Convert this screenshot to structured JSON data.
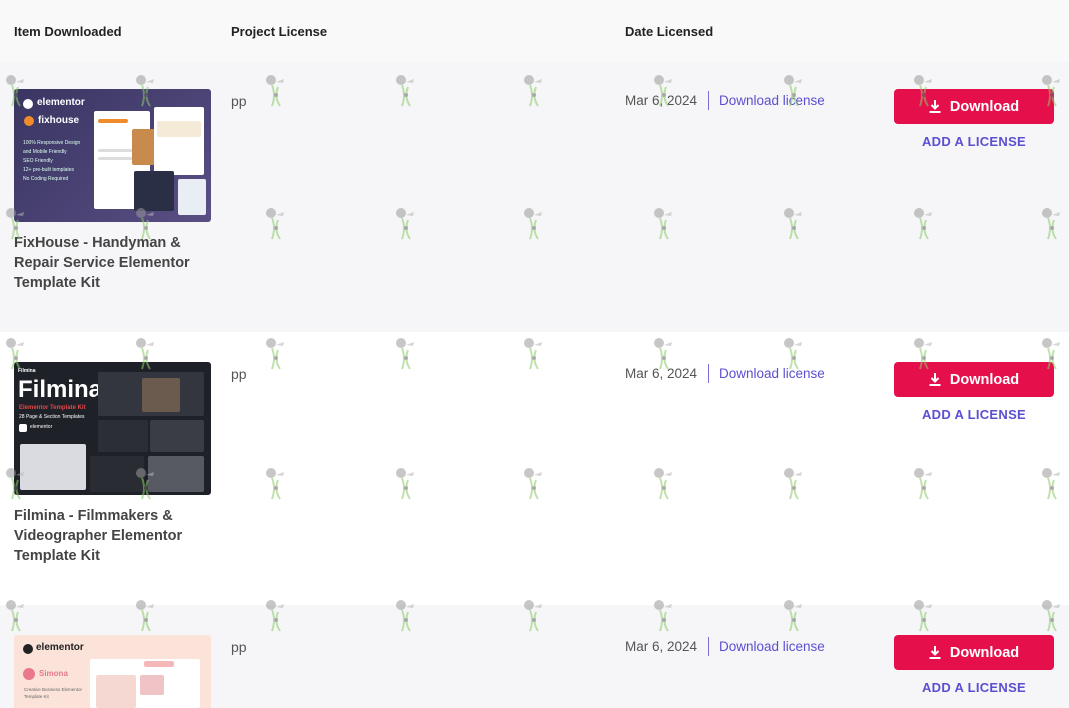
{
  "table": {
    "headers": {
      "item": "Item Downloaded",
      "project": "Project License",
      "date": "Date Licensed"
    },
    "rows": [
      {
        "title": "FixHouse - Handyman & Repair Service Elementor Template Kit",
        "project_license": "pp",
        "date": "Mar 6, 2024",
        "download_license_label": "Download license",
        "download_label": "Download",
        "add_license_label": "ADD A LICENSE",
        "thumb": {
          "brand": "elementor",
          "name": "fixhouse",
          "bullets": [
            "100% Responsive Design",
            "and Mobile Friendly",
            "SEO Friendly",
            "12+ pre-built templates",
            "No Coding Required"
          ]
        }
      },
      {
        "title": "Filmina - Filmmakers & Videographer Elementor Template Kit",
        "project_license": "pp",
        "date": "Mar 6, 2024",
        "download_license_label": "Download license",
        "download_label": "Download",
        "add_license_label": "ADD A LICENSE",
        "thumb": {
          "logo": "Filmina",
          "name": "Filmina",
          "subtitle": "Elementor Template Kit",
          "sub2": "28 Page & Section Templates",
          "brand": "elementor"
        }
      },
      {
        "title": "",
        "project_license": "pp",
        "date": "Mar 6, 2024",
        "download_license_label": "Download license",
        "download_label": "Download",
        "add_license_label": "ADD A LICENSE",
        "thumb": {
          "brand": "elementor",
          "name": "Simona",
          "subtitle": "Creative Business Elementor",
          "sub2": "Template Kit"
        }
      }
    ]
  },
  "colors": {
    "primary_button": "#e5104b",
    "link": "#5b4fd1",
    "alt_row": "#f6f6f8"
  },
  "icons": {
    "download": "download-icon"
  }
}
